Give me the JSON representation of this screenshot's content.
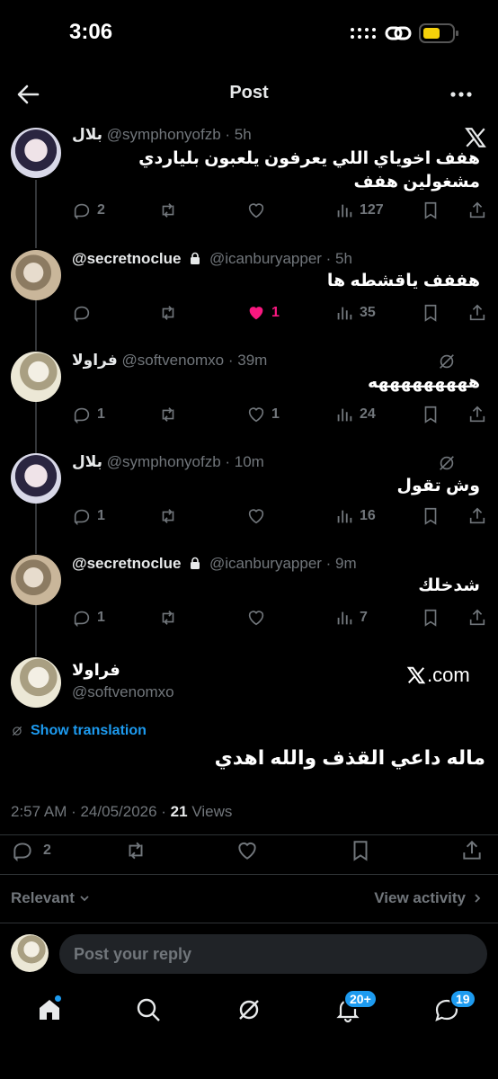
{
  "status": {
    "time": "3:06"
  },
  "header": {
    "title": "Post"
  },
  "replies": [
    {
      "name": "بلال",
      "handle": "@symphonyofzb",
      "time": "· 5h",
      "text": "هفف اخوياي اللي يعرفون يلعبون بلياردي مشغولين هفف",
      "mark": "x-logo",
      "reply_count": "2",
      "repost_count": "",
      "like_count": "",
      "view_count": "127"
    },
    {
      "name": "@secretnoclue",
      "handle": "@icanburyapper",
      "time": "· 5h",
      "text": "هففف ياقشطه ها",
      "locked": true,
      "reply_count": "",
      "repost_count": "",
      "like_count": "1",
      "liked": true,
      "view_count": "35"
    },
    {
      "name": "فراولا",
      "handle": "@softvenomxo",
      "time": "· 39m",
      "text": "هههههههههه",
      "mark": "grok-icon",
      "reply_count": "1",
      "repost_count": "",
      "like_count": "1",
      "view_count": "24"
    },
    {
      "name": "بلال",
      "handle": "@symphonyofzb",
      "time": "· 10m",
      "text": "وش تقول",
      "mark": "grok-icon",
      "reply_count": "1",
      "repost_count": "",
      "like_count": "",
      "view_count": "16"
    },
    {
      "name": "@secretnoclue",
      "handle": "@icanburyapper",
      "time": "· 9m",
      "text": "شدخلك",
      "locked": true,
      "reply_count": "1",
      "repost_count": "",
      "like_count": "",
      "view_count": "7"
    }
  ],
  "main": {
    "name": "فراولا",
    "handle": "@softvenomxo",
    "xcom": ".com",
    "show_translation": "Show translation",
    "text": "ماله داعي القذف والله اهدي",
    "meta_prefix": "2:57 AM · 24/05/2026 · ",
    "views": "21",
    "views_label": " Views",
    "reply_count": "2"
  },
  "sort": {
    "label": "Relevant",
    "view_activity": "View activity"
  },
  "reply": {
    "placeholder": "Post your reply"
  },
  "tabbar": {
    "notifications_badge": "20+",
    "messages_badge": "19"
  },
  "colors": {
    "accent": "#1d9bf0",
    "like": "#f91880",
    "muted": "#71767b"
  }
}
